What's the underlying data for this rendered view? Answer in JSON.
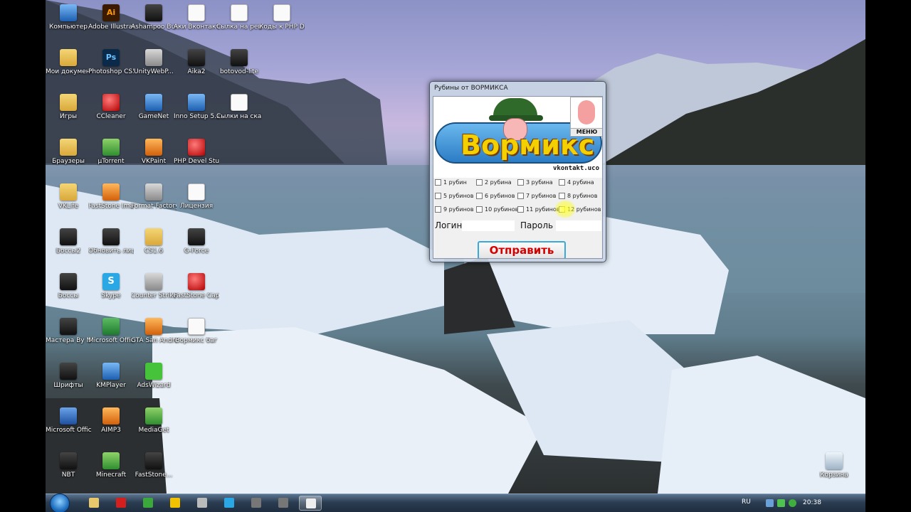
{
  "desktop": {
    "icons": [
      {
        "label": "Компьютер",
        "icon": "computer-icon"
      },
      {
        "label": "Adobe Illustrat...",
        "icon": "illustrator-icon"
      },
      {
        "label": "Ashampoo Burning ...",
        "icon": "ashampoo-icon"
      },
      {
        "label": "Аки Вконтакте",
        "icon": "text-file-icon"
      },
      {
        "label": "Сылка на решебник",
        "icon": "text-file-icon"
      },
      {
        "label": "Коды к PHP DevelStudio",
        "icon": "text-file-icon"
      },
      {
        "label": "Мои документы",
        "icon": "documents-folder-icon"
      },
      {
        "label": "Photoshop CS5",
        "icon": "photoshop-icon"
      },
      {
        "label": "UnityWebP...",
        "icon": "unity-icon"
      },
      {
        "label": "Aika2",
        "icon": "game-icon"
      },
      {
        "label": "botovod-lite",
        "icon": "app-icon"
      },
      {
        "label": "Игры",
        "icon": "folder-icon"
      },
      {
        "label": "CCleaner",
        "icon": "ccleaner-icon"
      },
      {
        "label": "GameNet",
        "icon": "gamenet-icon"
      },
      {
        "label": "Inno Setup 5.2.2",
        "icon": "inno-setup-icon"
      },
      {
        "label": "Сылки на скачку мо...",
        "icon": "text-file-icon"
      },
      {
        "label": "Браузеры",
        "icon": "folder-icon"
      },
      {
        "label": "µTorrent",
        "icon": "utorrent-icon"
      },
      {
        "label": "VKPaint",
        "icon": "vkpaint-icon"
      },
      {
        "label": "PHP Devel Studio 2.0",
        "icon": "php-devel-icon"
      },
      {
        "label": "VKLife",
        "icon": "folder-icon"
      },
      {
        "label": "FastStone Image Viewer",
        "icon": "faststone-icon"
      },
      {
        "label": "Format Factory",
        "icon": "format-factory-icon"
      },
      {
        "label": "Лицензия",
        "icon": "text-file-icon"
      },
      {
        "label": "Боссы2",
        "icon": "app-icon"
      },
      {
        "label": "Обновить лицензи...",
        "icon": "update-icon"
      },
      {
        "label": "CS1.6",
        "icon": "folder-icon"
      },
      {
        "label": "G-Force",
        "icon": "game-icon"
      },
      {
        "label": "Боссы",
        "icon": "app-icon"
      },
      {
        "label": "Skype",
        "icon": "skype-icon"
      },
      {
        "label": "Counter Strike 1.6",
        "icon": "counter-strike-icon"
      },
      {
        "label": "FastStone Capture",
        "icon": "faststone-capture-icon"
      },
      {
        "label": "Мастера By Nikurov",
        "icon": "app-icon"
      },
      {
        "label": "Microsoft Office Exc...",
        "icon": "excel-icon"
      },
      {
        "label": "GTA San Andreas -...",
        "icon": "gta-icon"
      },
      {
        "label": "Вормикс баг",
        "icon": "window-icon"
      },
      {
        "label": "Шрифты",
        "icon": "app-icon"
      },
      {
        "label": "KMPlayer",
        "icon": "kmplayer-icon"
      },
      {
        "label": "AdsWizard",
        "icon": "adswizard-icon"
      },
      {
        "label": "Microsoft Office Wo...",
        "icon": "word-icon"
      },
      {
        "label": "AIMP3",
        "icon": "aimp-icon"
      },
      {
        "label": "MediaGet",
        "icon": "mediaget-icon"
      },
      {
        "label": "NBT",
        "icon": "app-icon"
      },
      {
        "label": "Minecraft",
        "icon": "minecraft-icon"
      },
      {
        "label": "FastStone...",
        "icon": "app-icon"
      },
      {
        "label": "Корзина",
        "icon": "recycle-bin-icon"
      }
    ]
  },
  "dialog": {
    "title": "Рубины от ВОРМИКСА",
    "banner_word": "Вормикс",
    "banner_sub": "vkontakt.uco",
    "menu_label": "МЕНЮ",
    "options": [
      "1 рубин",
      "2 рубина",
      "3 рубина",
      "4 рубина",
      "5 рубинов",
      "6 рубинов",
      "7 рубинов",
      "8 рубинов",
      "9 рубинов",
      "10 рубинов",
      "11 рубинов",
      "12 рубинов"
    ],
    "login_label": "Логин",
    "password_label": "Пароль",
    "send_label": "Отправить"
  },
  "taskbar": {
    "apps": [
      "explorer-icon",
      "opera-icon",
      "utorrent-icon",
      "chrome-icon",
      "counter-strike-icon",
      "skype-icon",
      "app-icon",
      "app-icon",
      "window-icon"
    ],
    "active_index": 8,
    "language": "RU",
    "time": "20:38"
  }
}
